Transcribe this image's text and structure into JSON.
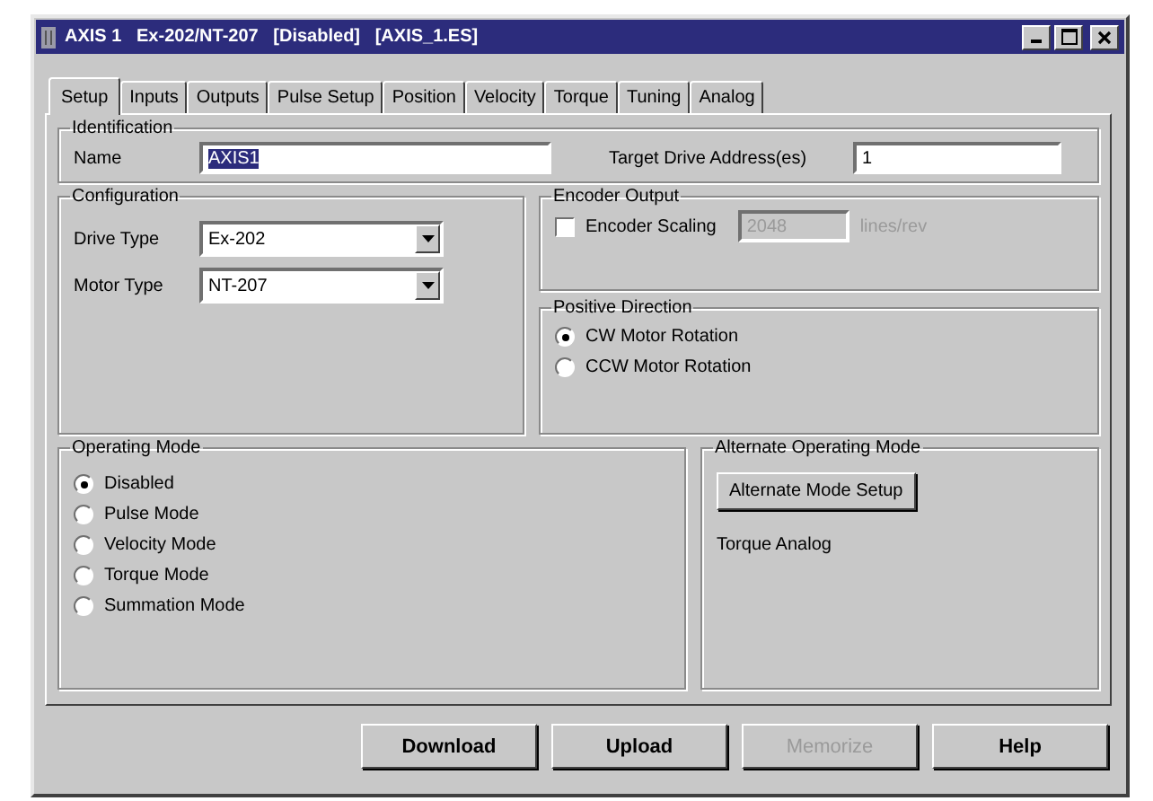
{
  "window": {
    "title": "AXIS 1   Ex-202/NT-207   [Disabled]   [AXIS_1.ES]"
  },
  "tabs": [
    {
      "label": "Setup",
      "selected": true
    },
    {
      "label": "Inputs",
      "selected": false
    },
    {
      "label": "Outputs",
      "selected": false
    },
    {
      "label": "Pulse Setup",
      "selected": false
    },
    {
      "label": "Position",
      "selected": false
    },
    {
      "label": "Velocity",
      "selected": false
    },
    {
      "label": "Torque",
      "selected": false
    },
    {
      "label": "Tuning",
      "selected": false
    },
    {
      "label": "Analog",
      "selected": false
    }
  ],
  "identification": {
    "title": "Identification",
    "name_label": "Name",
    "name_value": "AXIS1",
    "name_text_selected": true,
    "target_label": "Target Drive Address(es)",
    "target_value": "1"
  },
  "configuration": {
    "title": "Configuration",
    "fields": [
      {
        "label": "Drive Type",
        "value": "Ex-202"
      },
      {
        "label": "Motor Type",
        "value": "NT-207"
      }
    ]
  },
  "encoder_output": {
    "title": "Encoder Output",
    "checkbox_label": "Encoder Scaling",
    "checked": false,
    "value": "2048",
    "disabled": true,
    "units": "lines/rev"
  },
  "positive_direction": {
    "title": "Positive Direction",
    "options": [
      {
        "label": "CW Motor Rotation",
        "selected": true
      },
      {
        "label": "CCW Motor Rotation",
        "selected": false
      }
    ]
  },
  "operating_mode": {
    "title": "Operating Mode",
    "options": [
      {
        "label": "Disabled",
        "selected": true
      },
      {
        "label": "Pulse Mode",
        "selected": false
      },
      {
        "label": "Velocity Mode",
        "selected": false
      },
      {
        "label": "Torque Mode",
        "selected": false
      },
      {
        "label": "Summation Mode",
        "selected": false
      }
    ]
  },
  "alternate_mode": {
    "title": "Alternate Operating Mode",
    "button": "Alternate Mode Setup",
    "text": "Torque Analog"
  },
  "buttons": [
    {
      "label": "Download",
      "disabled": false
    },
    {
      "label": "Upload",
      "disabled": false
    },
    {
      "label": "Memorize",
      "disabled": true
    },
    {
      "label": "Help",
      "disabled": false
    }
  ]
}
